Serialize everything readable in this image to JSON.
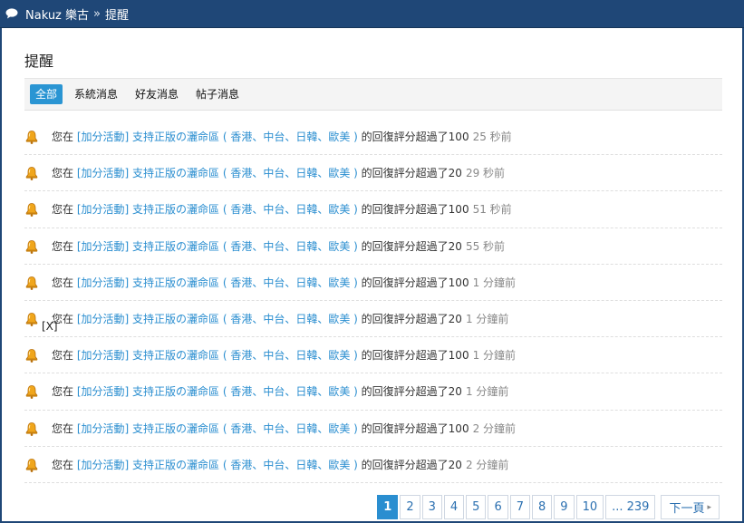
{
  "breadcrumb": {
    "site": "Nakuz 樂古",
    "separator": "»",
    "current": "提醒"
  },
  "page_title": "提醒",
  "tabs": [
    {
      "label": "全部",
      "active": true
    },
    {
      "label": "系統消息",
      "active": false
    },
    {
      "label": "好友消息",
      "active": false
    },
    {
      "label": "帖子消息",
      "active": false
    }
  ],
  "notifications": [
    {
      "prefix": "您在",
      "thread": "[加分活動] 支持正版の灑命區 ( 香港、中台、日韓、歐美 )",
      "suffix": "的回復評分超過了100",
      "time": "25 秒前"
    },
    {
      "prefix": "您在",
      "thread": "[加分活動] 支持正版の灑命區 ( 香港、中台、日韓、歐美 )",
      "suffix": "的回復評分超過了20",
      "time": "29 秒前"
    },
    {
      "prefix": "您在",
      "thread": "[加分活動] 支持正版の灑命區 ( 香港、中台、日韓、歐美 )",
      "suffix": "的回復評分超過了100",
      "time": "51 秒前"
    },
    {
      "prefix": "您在",
      "thread": "[加分活動] 支持正版の灑命區 ( 香港、中台、日韓、歐美 )",
      "suffix": "的回復評分超過了20",
      "time": "55 秒前"
    },
    {
      "prefix": "您在",
      "thread": "[加分活動] 支持正版の灑命區 ( 香港、中台、日韓、歐美 )",
      "suffix": "的回復評分超過了100",
      "time": "1 分鐘前"
    },
    {
      "prefix": "您在",
      "thread": "[加分活動] 支持正版の灑命區 ( 香港、中台、日韓、歐美 )",
      "suffix": "的回復評分超過了20",
      "time": "1 分鐘前"
    },
    {
      "prefix": "您在",
      "thread": "[加分活動] 支持正版の灑命區 ( 香港、中台、日韓、歐美 )",
      "suffix": "的回復評分超過了100",
      "time": "1 分鐘前"
    },
    {
      "prefix": "您在",
      "thread": "[加分活動] 支持正版の灑命區 ( 香港、中台、日韓、歐美 )",
      "suffix": "的回復評分超過了20",
      "time": "1 分鐘前"
    },
    {
      "prefix": "您在",
      "thread": "[加分活動] 支持正版の灑命區 ( 香港、中台、日韓、歐美 )",
      "suffix": "的回復評分超過了100",
      "time": "2 分鐘前"
    },
    {
      "prefix": "您在",
      "thread": "[加分活動] 支持正版の灑命區 ( 香港、中台、日韓、歐美 )",
      "suffix": "的回復評分超過了20",
      "time": "2 分鐘前"
    }
  ],
  "close_label": "[X]",
  "pagination": {
    "pages": [
      "1",
      "2",
      "3",
      "4",
      "5",
      "6",
      "7",
      "8",
      "9",
      "10",
      "... 239"
    ],
    "current": "1",
    "next_label": "下一頁"
  },
  "colors": {
    "topbar": "#1f4777",
    "accent": "#2a8ed0",
    "bell": "#e8a317"
  },
  "icons": {
    "bubble": "speech-bubble-icon",
    "bell": "bell-icon",
    "next": "chevron-right-icon"
  }
}
